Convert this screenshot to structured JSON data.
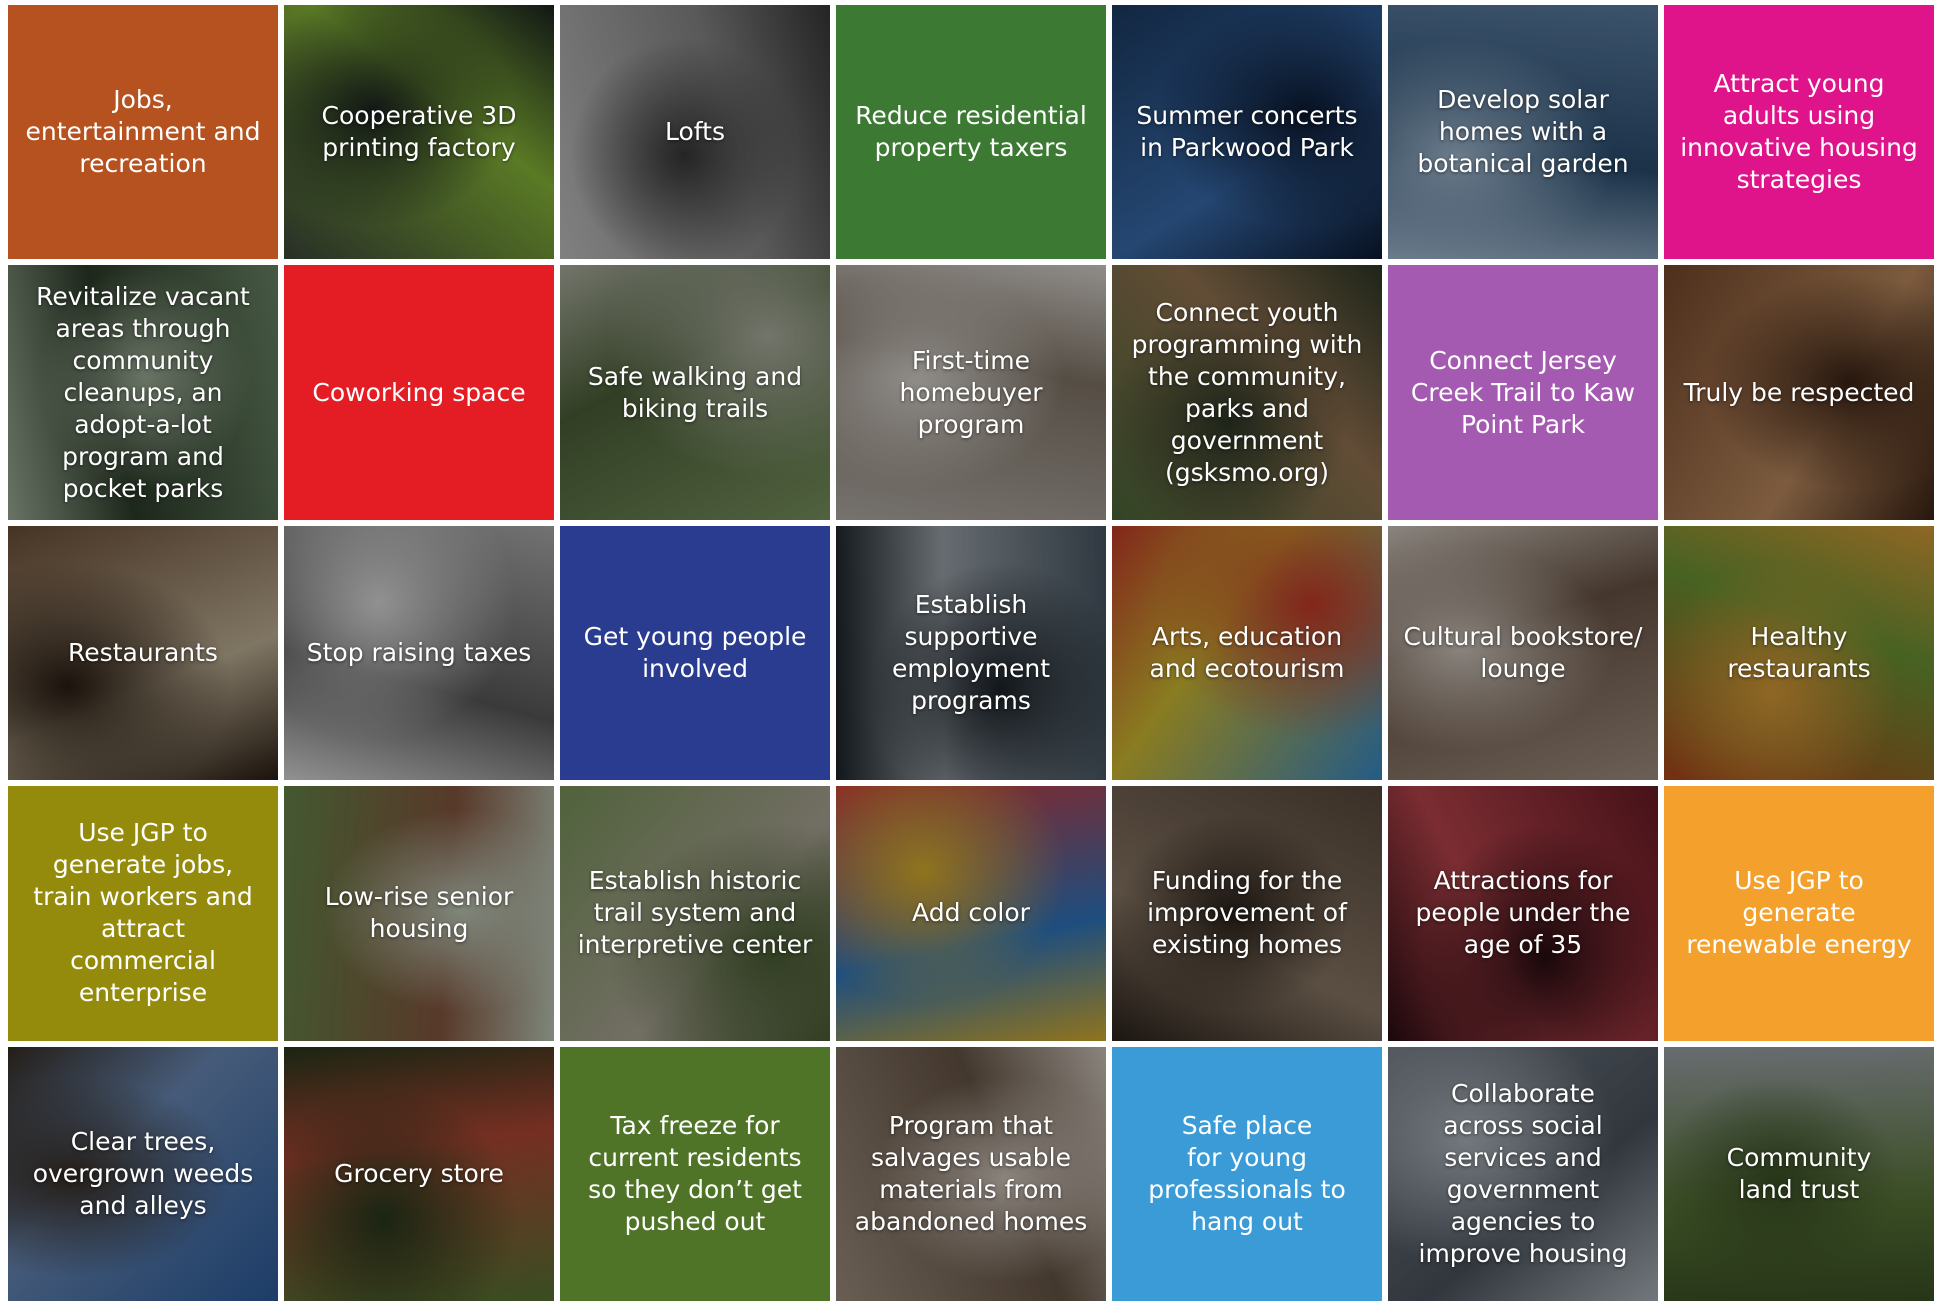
{
  "tiles": [
    {
      "label": "Jobs,\nentertainment and\nrecreation",
      "kind": "solid",
      "color": "#b5521f"
    },
    {
      "label": "Cooperative 3D\nprinting factory",
      "kind": "photo",
      "colors": [
        "#3f4a3d",
        "#8dbf3a",
        "#1c2522"
      ],
      "icon": "3d-printer-photo"
    },
    {
      "label": "Lofts",
      "kind": "photo",
      "colors": [
        "#c9c9c9",
        "#8c8c8c",
        "#3a3a3a"
      ],
      "icon": "loft-interior-photo"
    },
    {
      "label": "Reduce residential\nproperty taxers",
      "kind": "solid",
      "color": "#3c7a33"
    },
    {
      "label": "Summer concerts\nin Parkwood Park",
      "kind": "photo",
      "colors": [
        "#1d3d66",
        "#3a6fb2",
        "#0c1a33"
      ],
      "icon": "concert-photo"
    },
    {
      "label": "Develop solar\nhomes with a\nbotanical garden",
      "kind": "photo",
      "colors": [
        "#5e83a8",
        "#2b4f73",
        "#a8c2da"
      ],
      "icon": "solar-panel-photo"
    },
    {
      "label": "Attract young\nadults using\ninnovative housing\nstrategies",
      "kind": "solid",
      "color": "#e0148a"
    },
    {
      "label": "Revitalize vacant\nareas through\ncommunity\ncleanups, an\nadopt-a-lot\nprogram and\npocket parks",
      "kind": "photo",
      "colors": [
        "#6f8c6a",
        "#2e3f2c",
        "#a5b59e"
      ],
      "icon": "community-cleanup-photo"
    },
    {
      "label": "Coworking space",
      "kind": "solid",
      "color": "#e41c24"
    },
    {
      "label": "Safe walking and\nbiking trails",
      "kind": "photo",
      "colors": [
        "#7f9a64",
        "#4e6239",
        "#b4b8a8"
      ],
      "icon": "bike-trail-photo"
    },
    {
      "label": "First-time\nhomebuyer\nprogram",
      "kind": "photo",
      "colors": [
        "#b9b3ac",
        "#867a6c",
        "#e1dcd6"
      ],
      "icon": "house-key-photo"
    },
    {
      "label": "Connect youth\nprogramming with\nthe community,\nparks and\ngovernment\n(gsksmo.org)",
      "kind": "photo",
      "colors": [
        "#4f6b3b",
        "#9a7855",
        "#2f3a28"
      ],
      "icon": "youth-baseball-photo"
    },
    {
      "label": "Connect Jersey\nCreek Trail to Kaw\nPoint Park",
      "kind": "solid",
      "color": "#a45ab0"
    },
    {
      "label": "Truly be respected",
      "kind": "photo",
      "colors": [
        "#7a4a2c",
        "#c28f62",
        "#3d2416"
      ],
      "icon": "holding-hands-photo"
    },
    {
      "label": "Restaurants",
      "kind": "photo",
      "colors": [
        "#6e5038",
        "#c8b89c",
        "#2b1e14"
      ],
      "icon": "restaurant-plates-photo"
    },
    {
      "label": "Stop raising taxes",
      "kind": "photo",
      "colors": [
        "#b3b3b3",
        "#5c5c5c",
        "#e3e3e3"
      ],
      "icon": "calculator-photo"
    },
    {
      "label": "Get young people\ninvolved",
      "kind": "solid",
      "color": "#2a3c8f"
    },
    {
      "label": "Establish\nsupportive\nemployment\nprograms",
      "kind": "photo",
      "colors": [
        "#4b5a66",
        "#a0a9b0",
        "#1d252c"
      ],
      "icon": "welder-photo"
    },
    {
      "label": "Arts, education\nand ecotourism",
      "kind": "photo",
      "colors": [
        "#3a8fd1",
        "#d7c234",
        "#cc3c2a"
      ],
      "icon": "mural-painting-photo"
    },
    {
      "label": "Cultural bookstore/\nlounge",
      "kind": "photo",
      "colors": [
        "#a99686",
        "#6c5646",
        "#d8cfc6"
      ],
      "icon": "open-book-photo"
    },
    {
      "label": "Healthy\nrestaurants",
      "kind": "photo",
      "colors": [
        "#b44a1c",
        "#6f9a36",
        "#e0a13a"
      ],
      "icon": "vegetables-photo"
    },
    {
      "label": "Use JGP to\ngenerate jobs,\ntrain workers and\nattract\ncommercial\nenterprise",
      "kind": "solid",
      "color": "#948b0c"
    },
    {
      "label": "Low-rise senior\nhousing",
      "kind": "photo",
      "colors": [
        "#6a8a4c",
        "#8a5a42",
        "#c6d2c0"
      ],
      "icon": "senior-housing-photo"
    },
    {
      "label": "Establish historic\ntrail system and\ninterpretive center",
      "kind": "photo",
      "colors": [
        "#7e9a5e",
        "#b3ad9c",
        "#4e6237"
      ],
      "icon": "statue-monument-photo"
    },
    {
      "label": "Add color",
      "kind": "photo",
      "colors": [
        "#d83b3b",
        "#2f7ac6",
        "#e0b52f"
      ],
      "icon": "colorful-museum-wall-photo"
    },
    {
      "label": "Funding for the\nimprovement of\nexisting homes",
      "kind": "photo",
      "colors": [
        "#5b4b3d",
        "#8f7c69",
        "#2c231c"
      ],
      "icon": "home-repair-photo"
    },
    {
      "label": "Attractions for\npeople under the\nage of 35",
      "kind": "photo",
      "colors": [
        "#6e1c26",
        "#c0474f",
        "#2a0d12"
      ],
      "icon": "wine-glass-photo"
    },
    {
      "label": "Use JGP to\ngenerate\nrenewable energy",
      "kind": "solid",
      "color": "#f3a02c"
    },
    {
      "label": "Clear trees,\novergrown weeds\nand alleys",
      "kind": "photo",
      "colors": [
        "#2d5fa3",
        "#6e8fbd",
        "#3a2f25"
      ],
      "icon": "bare-trees-photo"
    },
    {
      "label": "Grocery store",
      "kind": "photo",
      "colors": [
        "#5a7a36",
        "#b84a36",
        "#2a3a1e"
      ],
      "icon": "produce-market-photo"
    },
    {
      "label": "Tax freeze for\ncurrent residents\nso they don’t get\npushed out",
      "kind": "solid",
      "color": "#4f7428"
    },
    {
      "label": "Program that\nsalvages usable\nmaterials from\nabandoned homes",
      "kind": "photo",
      "colors": [
        "#a59484",
        "#6a5848",
        "#d9cfc4"
      ],
      "icon": "salvaged-door-photo"
    },
    {
      "label": "Safe place\nfor young\nprofessionals to\nhang out",
      "kind": "solid",
      "color": "#3a9bd6"
    },
    {
      "label": "Collaborate\nacross social\nservices and\ngovernment\nagencies to\nimprove housing",
      "kind": "photo",
      "colors": [
        "#7b8590",
        "#4d5660",
        "#b4bcc4"
      ],
      "icon": "townhouse-photo"
    },
    {
      "label": "Community\nland trust",
      "kind": "photo",
      "colors": [
        "#a4aab0",
        "#5d7a3a",
        "#3c5426"
      ],
      "icon": "green-lawn-house-photo"
    }
  ]
}
